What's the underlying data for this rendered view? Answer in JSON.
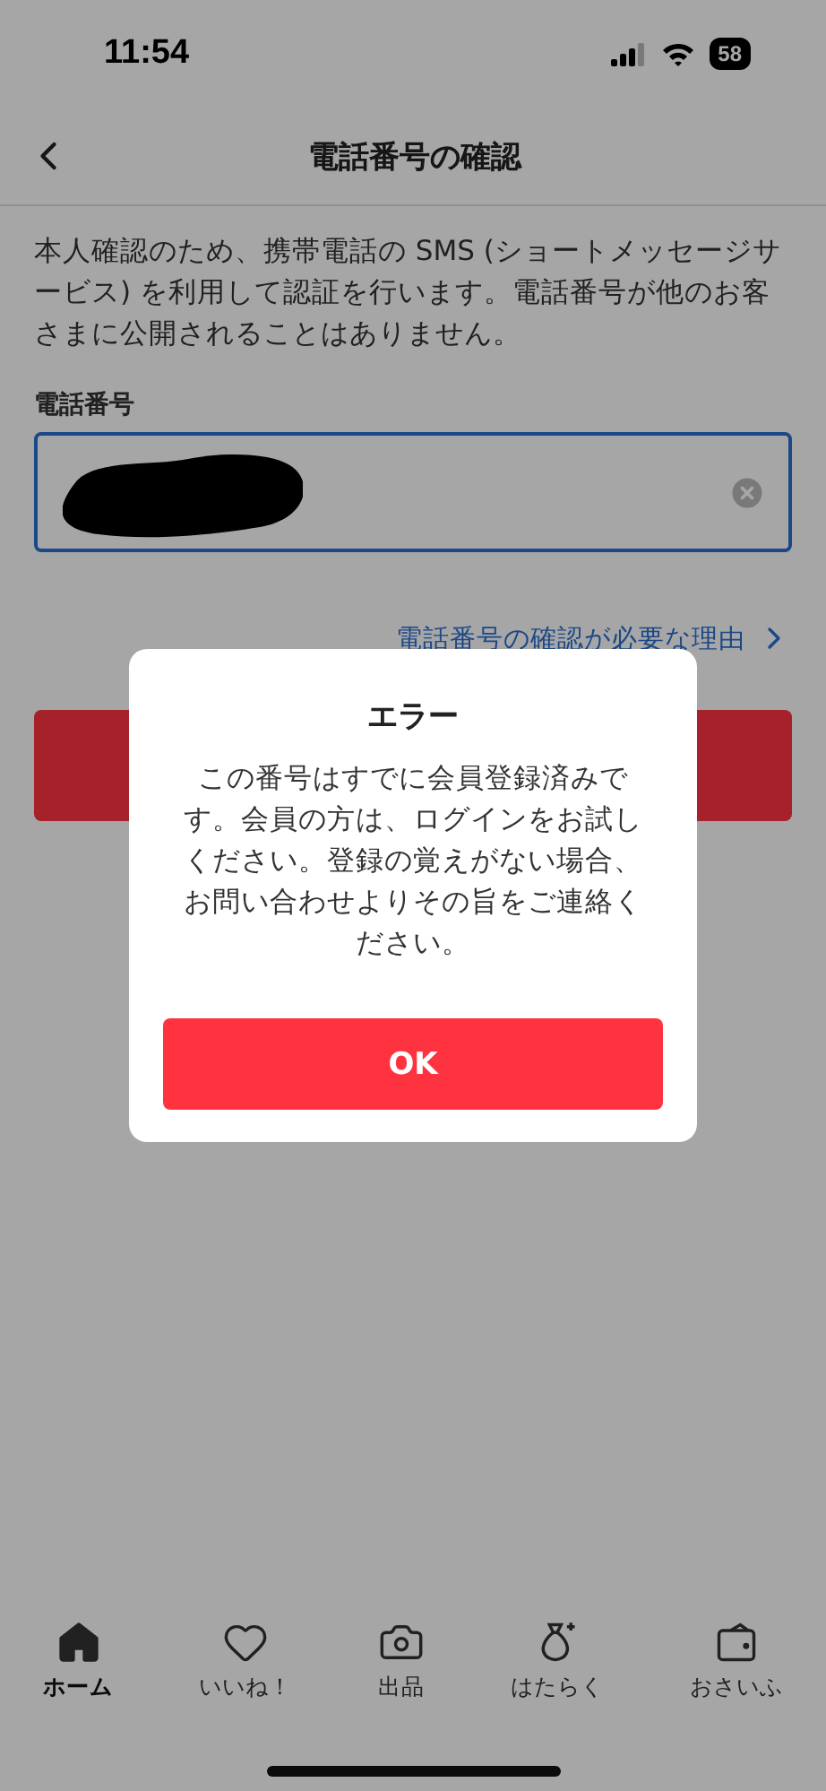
{
  "status_bar": {
    "time": "11:54",
    "battery": "58"
  },
  "header": {
    "title": "電話番号の確認"
  },
  "description": "本人確認のため、携帯電話の SMS (ショートメッセージサービス) を利用して認証を行います。電話番号が他のお客さまに公開されることはありません。",
  "phone_field": {
    "label": "電話番号",
    "redacted": true
  },
  "reason_link": "電話番号の確認が必要な理由",
  "dialog": {
    "title": "エラー",
    "message": "この番号はすでに会員登録済みです。会員の方は、ログインをお試しください。登録の覚えがない場合、お問い合わせよりその旨をご連絡ください。",
    "button": "OK"
  },
  "tab_bar": [
    {
      "kind": "home",
      "label": "ホーム",
      "selected": true
    },
    {
      "kind": "like",
      "label": "いいね！",
      "selected": false
    },
    {
      "kind": "sell",
      "label": "出品",
      "selected": false
    },
    {
      "kind": "work",
      "label": "はたらく",
      "selected": false
    },
    {
      "kind": "wallet",
      "label": "おさいふ",
      "selected": false
    }
  ]
}
